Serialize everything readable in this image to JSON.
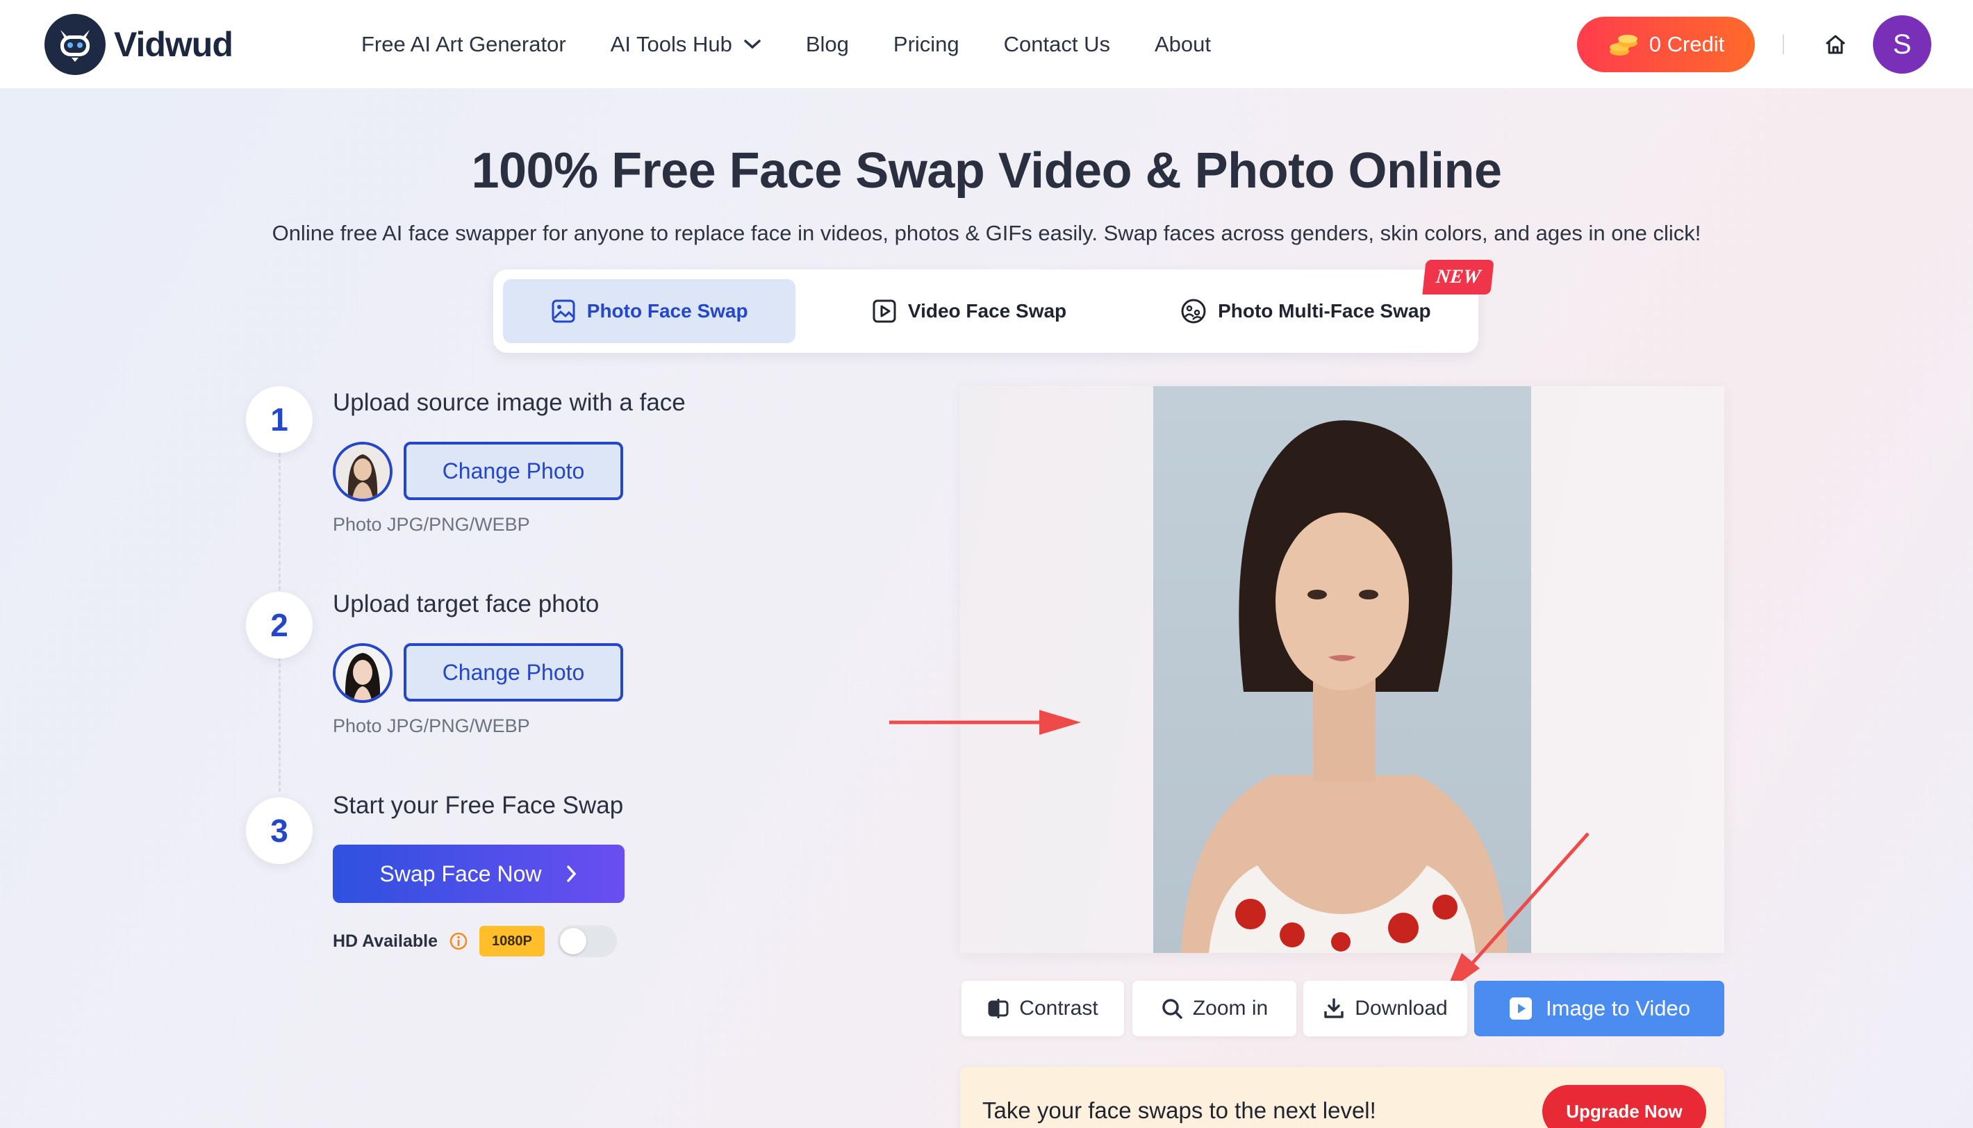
{
  "brand": {
    "name": "Vidwud"
  },
  "nav": {
    "items": [
      {
        "label": "Free AI Art Generator"
      },
      {
        "label": "AI Tools Hub"
      },
      {
        "label": "Blog"
      },
      {
        "label": "Pricing"
      },
      {
        "label": "Contact Us"
      },
      {
        "label": "About"
      }
    ],
    "credit_label": "0 Credit",
    "avatar_initial": "S"
  },
  "hero": {
    "title": "100% Free Face Swap Video & Photo Online",
    "subtitle": "Online free AI face swapper for anyone to replace face in videos, photos & GIFs easily. Swap faces across genders, skin colors, and ages in one click!"
  },
  "tabs": [
    {
      "label": "Photo Face Swap",
      "active": true,
      "icon": "image-icon"
    },
    {
      "label": "Video Face Swap",
      "active": false,
      "icon": "play-square-icon"
    },
    {
      "label": "Photo Multi-Face Swap",
      "active": false,
      "icon": "multi-face-icon",
      "badge": "NEW"
    }
  ],
  "steps": [
    {
      "number": "1",
      "title": "Upload source image with a face",
      "button": "Change Photo",
      "hint": "Photo JPG/PNG/WEBP"
    },
    {
      "number": "2",
      "title": "Upload target face photo",
      "button": "Change Photo",
      "hint": "Photo JPG/PNG/WEBP"
    },
    {
      "number": "3",
      "title": "Start your Free Face Swap",
      "button": "Swap Face Now"
    }
  ],
  "hd": {
    "label": "HD Available",
    "badge": "1080P",
    "enabled": false
  },
  "toolbar": {
    "contrast": "Contrast",
    "zoom": "Zoom in",
    "download": "Download",
    "image_to_video": "Image to Video"
  },
  "upgrade": {
    "text": "Take your face swaps to the next level!",
    "button": "Upgrade Now"
  },
  "colors": {
    "accent": "#2446c8",
    "credit_gradient_start": "#ff3d4d",
    "credit_gradient_end": "#ff6a2b",
    "upgrade_button": "#e72a36",
    "image_to_video": "#4b8cf0",
    "annotation_arrow": "#ef4a4a"
  }
}
